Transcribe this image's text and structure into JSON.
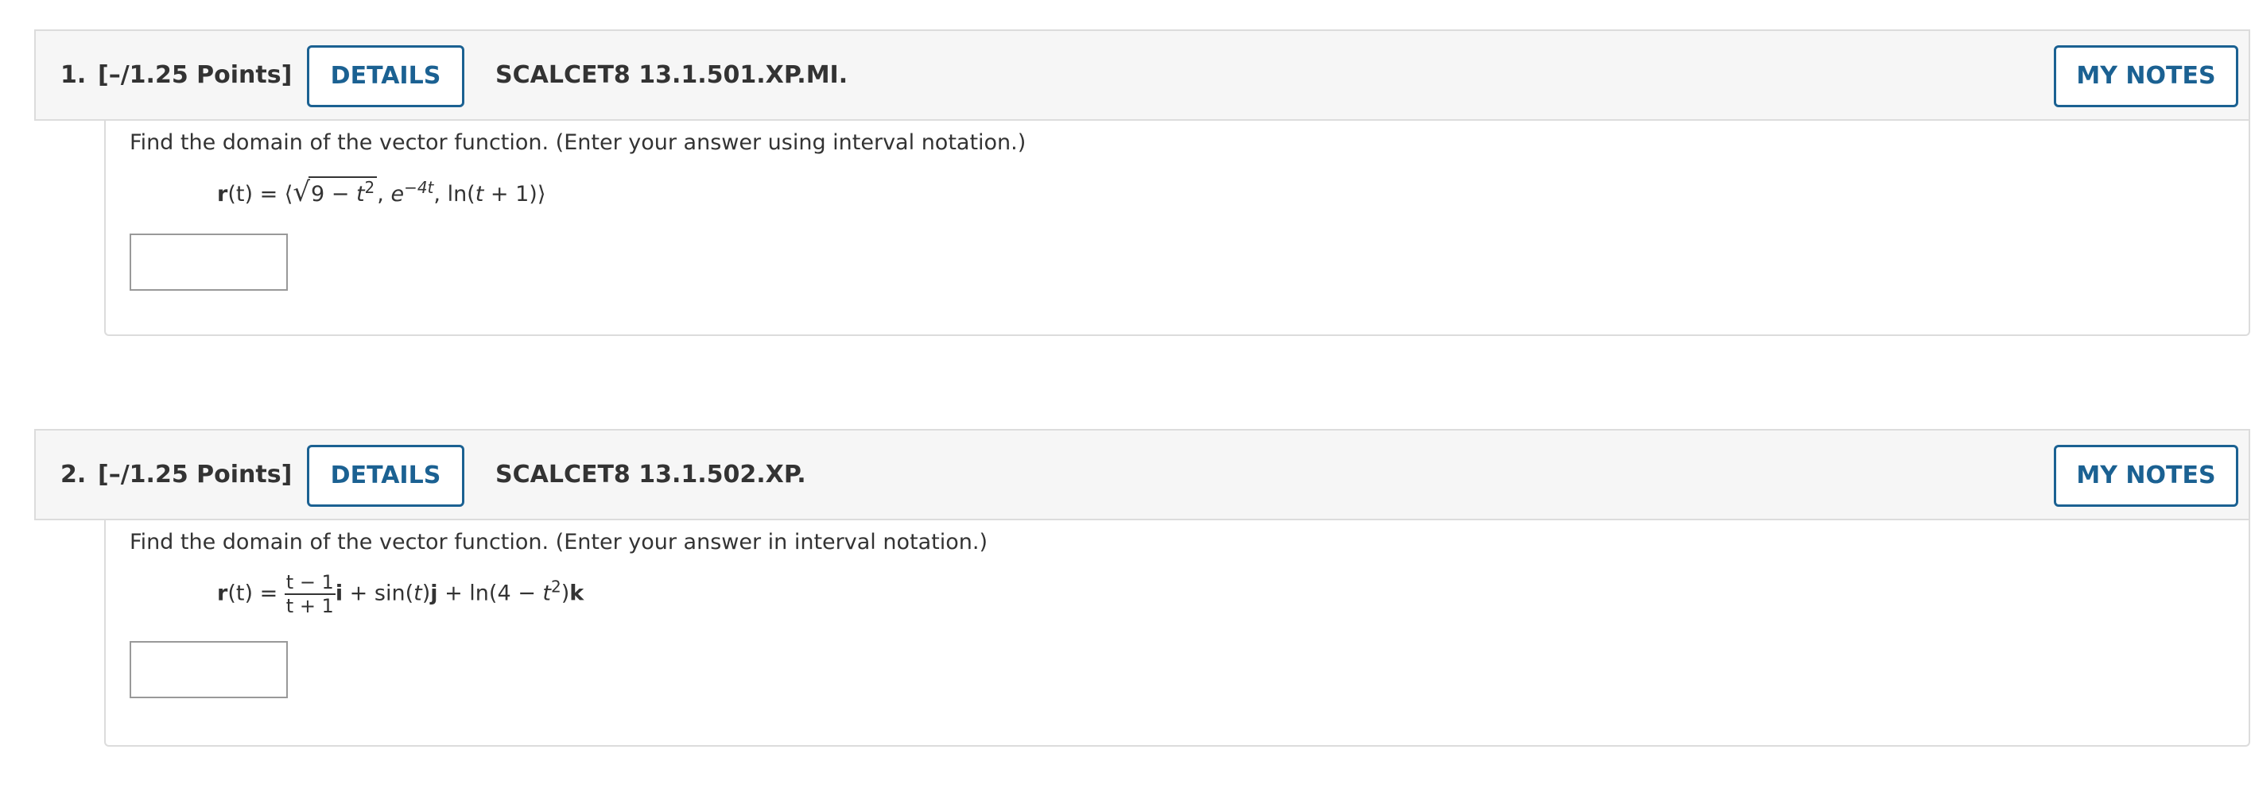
{
  "questions": [
    {
      "number": "1.",
      "points": "[–/1.25 Points]",
      "details_label": "DETAILS",
      "code": "SCALCET8 13.1.501.XP.MI.",
      "my_notes_label": "MY NOTES",
      "prompt": "Find the domain of the vector function. (Enter your answer using interval notation.)",
      "formula": {
        "lhs_r": "r",
        "lhs_t": "(t) = ⟨",
        "sqrt_body": "9 − ",
        "sqrt_t": "t",
        "sqrt_exp": "2",
        "after_sqrt": ", ",
        "exp_base": "e",
        "exp_power": "−4t",
        "tail": ", ln(",
        "tail_t": "t",
        "tail_end": " + 1)⟩"
      },
      "answer": ""
    },
    {
      "number": "2.",
      "points": "[–/1.25 Points]",
      "details_label": "DETAILS",
      "code": "SCALCET8 13.1.502.XP.",
      "my_notes_label": "MY NOTES",
      "prompt": "Find the domain of the vector function. (Enter your answer in interval notation.)",
      "formula": {
        "lhs_r": "r",
        "lhs_t": "(t) = ",
        "frac_num": "t − 1",
        "frac_den": "t + 1",
        "unit_i": "i",
        "mid": " + sin(",
        "mid_t": "t",
        "mid_close": ")",
        "unit_j": "j",
        "ln_part": " + ln(4 − ",
        "ln_t": "t",
        "ln_exp": "2",
        "ln_close": ")",
        "unit_k": "k"
      },
      "answer": ""
    }
  ]
}
